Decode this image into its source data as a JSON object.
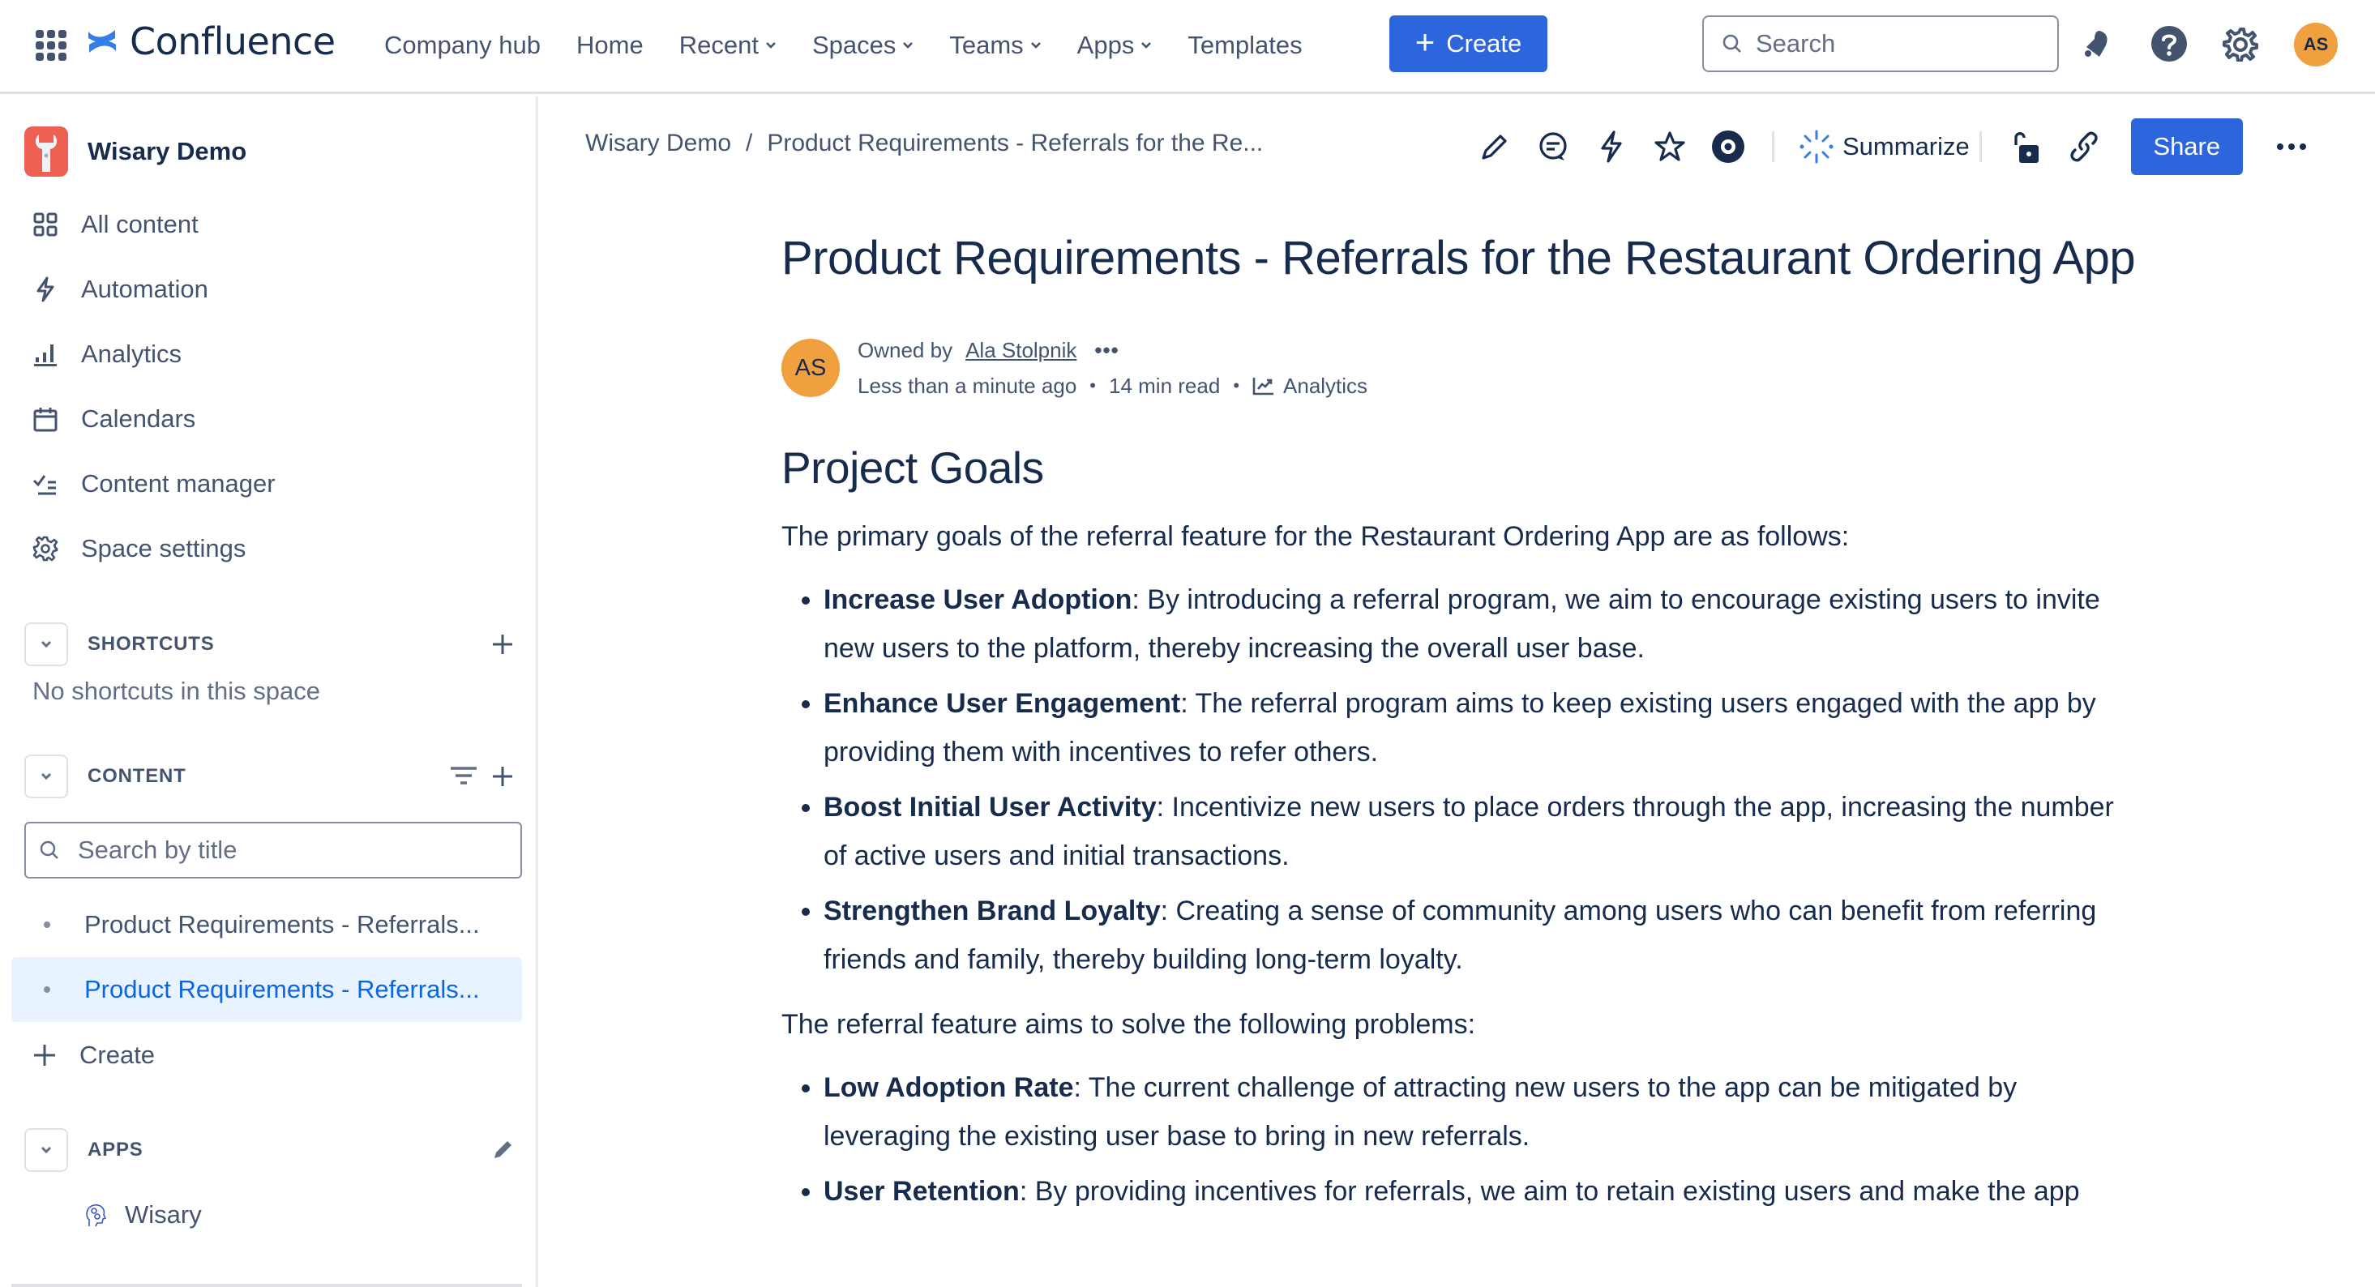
{
  "topnav": {
    "app_name": "Confluence",
    "items": [
      {
        "label": "Company hub",
        "has_dropdown": false
      },
      {
        "label": "Home",
        "has_dropdown": false
      },
      {
        "label": "Recent",
        "has_dropdown": true
      },
      {
        "label": "Spaces",
        "has_dropdown": true
      },
      {
        "label": "Teams",
        "has_dropdown": true
      },
      {
        "label": "Apps",
        "has_dropdown": true
      },
      {
        "label": "Templates",
        "has_dropdown": false
      }
    ],
    "create_label": "Create",
    "search_placeholder": "Search",
    "icons": [
      "notifications-icon",
      "help-icon",
      "settings-icon"
    ],
    "avatar_initials": "AS"
  },
  "sidebar": {
    "space_name": "Wisary Demo",
    "nav": [
      {
        "label": "All content",
        "icon": "all-content-icon"
      },
      {
        "label": "Automation",
        "icon": "lightning-icon"
      },
      {
        "label": "Analytics",
        "icon": "bar-chart-icon"
      },
      {
        "label": "Calendars",
        "icon": "calendar-icon"
      },
      {
        "label": "Content manager",
        "icon": "checklist-icon"
      },
      {
        "label": "Space settings",
        "icon": "gear-icon"
      }
    ],
    "shortcuts": {
      "label": "SHORTCUTS",
      "empty": "No shortcuts in this space"
    },
    "content": {
      "label": "CONTENT",
      "search_placeholder": "Search by title",
      "tree": [
        {
          "label": "Product Requirements - Referrals...",
          "active": false
        },
        {
          "label": "Product Requirements - Referrals...",
          "active": true
        }
      ],
      "create_label": "Create"
    },
    "apps": {
      "label": "APPS",
      "items": [
        {
          "label": "Wisary"
        }
      ]
    }
  },
  "page": {
    "breadcrumb": [
      "Wisary Demo",
      "Product Requirements - Referrals for the Re..."
    ],
    "breadcrumb_sep": "/",
    "summarize_label": "Summarize",
    "share_label": "Share",
    "title": "Product Requirements - Referrals for the Restaurant Ordering App",
    "byline": {
      "avatar_initials": "AS",
      "owned_by_prefix": "Owned by",
      "owner": "Ala Stolpnik",
      "updated": "Less than a minute ago",
      "read_time": "14 min read",
      "analytics_label": "Analytics"
    },
    "section_title": "Project Goals",
    "intro": "The primary goals of the referral feature for the Restaurant Ordering App are as follows:",
    "goals": [
      {
        "title": "Increase User Adoption",
        "text": ": By introducing a referral program, we aim to encourage existing users to invite new users to the platform, thereby increasing the overall user base."
      },
      {
        "title": "Enhance User Engagement",
        "text": ": The referral program aims to keep existing users engaged with the app by providing them with incentives to refer others."
      },
      {
        "title": "Boost Initial User Activity",
        "text": ": Incentivize new users to place orders through the app, increasing the number of active users and initial transactions."
      },
      {
        "title": "Strengthen Brand Loyalty",
        "text": ": Creating a sense of community among users who can benefit from referring friends and family, thereby building long-term loyalty."
      }
    ],
    "problems_intro": "The referral feature aims to solve the following problems:",
    "problems": [
      {
        "title": "Low Adoption Rate",
        "text": ": The current challenge of attracting new users to the app can be mitigated by leveraging the existing user base to bring in new referrals."
      },
      {
        "title": "User Retention",
        "text": ": By providing incentives for referrals, we aim to retain existing users and make the app"
      }
    ]
  },
  "colors": {
    "brand_blue": "#2d66dc",
    "avatar_orange": "#f0a03f",
    "space_icon_red": "#ee6052",
    "active_item_bg": "#e9f2ff",
    "active_item_text": "#0c66e4"
  }
}
